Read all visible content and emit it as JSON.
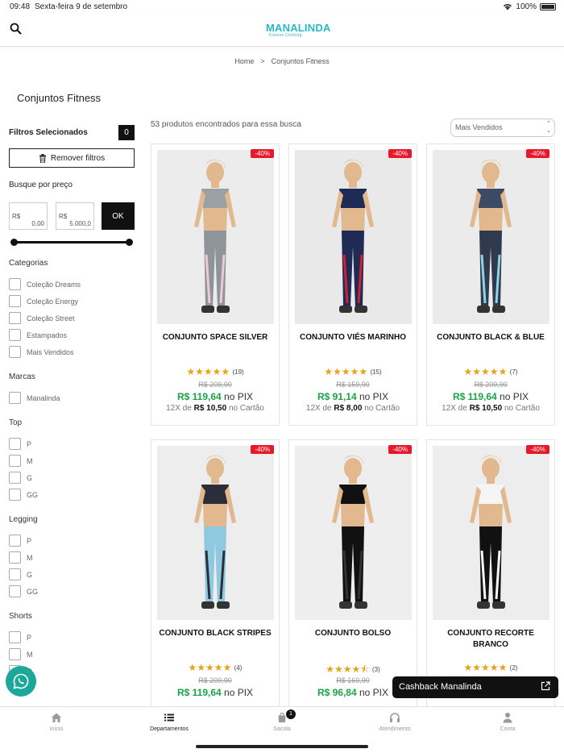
{
  "status_bar": {
    "time": "09:48",
    "date": "Sexta-feira 9 de setembro",
    "battery": "100%"
  },
  "header": {
    "logo_text": "MANALINDA",
    "logo_tagline": "Fitness Clothing",
    "logo_color": "#2ab7c9"
  },
  "breadcrumb": {
    "home": "Home",
    "separator": ">",
    "current": "Conjuntos Fitness"
  },
  "page_title": "Conjuntos Fitness",
  "filters": {
    "selected_label": "Filtros Selecionados",
    "selected_count": "0",
    "remove_label": "Remover filtros",
    "price_label": "Busque por preço",
    "min_currency": "R$",
    "min_value": "0,00",
    "max_currency": "R$",
    "max_value": "5.000,0",
    "ok_label": "OK",
    "groups": [
      {
        "title": "Categorias",
        "items": [
          "Coleção Dreams",
          "Coleção Energy",
          "Coleção Street",
          "Estampados",
          "Mais Vendidos"
        ]
      },
      {
        "title": "Marcas",
        "items": [
          "Manalinda"
        ]
      },
      {
        "title": "Top",
        "items": [
          "P",
          "M",
          "G",
          "GG"
        ]
      },
      {
        "title": "Legging",
        "items": [
          "P",
          "M",
          "G",
          "GG"
        ]
      },
      {
        "title": "Shorts",
        "items": [
          "P",
          "M",
          "G"
        ]
      }
    ]
  },
  "results": {
    "count_text": "53 produtos encontrados para essa busca",
    "sort_value": "Mais Vendidos"
  },
  "products": [
    {
      "name": "CONJUNTO SPACE SILVER",
      "discount": "-40%",
      "stars": 5,
      "reviews": "(19)",
      "old_price": "R$ 209,90",
      "pix_price": "R$ 119,64",
      "pix_label": "no PIX",
      "installments_prefix": "12X de",
      "installment_value": "R$ 10,50",
      "installments_suffix": "no Cartão"
    },
    {
      "name": "CONJUNTO VIÉS MARINHO",
      "discount": "-40%",
      "stars": 5,
      "reviews": "(15)",
      "old_price": "R$ 159,90",
      "pix_price": "R$ 91,14",
      "pix_label": "no PIX",
      "installments_prefix": "12X de",
      "installment_value": "R$ 8,00",
      "installments_suffix": "no Cartão"
    },
    {
      "name": "CONJUNTO BLACK & BLUE",
      "discount": "-40%",
      "stars": 5,
      "reviews": "(7)",
      "old_price": "R$ 209,90",
      "pix_price": "R$ 119,64",
      "pix_label": "no PIX",
      "installments_prefix": "12X de",
      "installment_value": "R$ 10,50",
      "installments_suffix": "no Cartão"
    },
    {
      "name": "CONJUNTO BLACK STRIPES",
      "discount": "-40%",
      "stars": 5,
      "reviews": "(4)",
      "old_price": "R$ 209,90",
      "pix_price": "R$ 119,64",
      "pix_label": "no PIX"
    },
    {
      "name": "CONJUNTO BOLSO",
      "discount": "-40%",
      "stars": 4.5,
      "reviews": "(3)",
      "old_price": "R$ 169,90",
      "pix_price": "R$ 96,84",
      "pix_label": "no PIX"
    },
    {
      "name": "CONJUNTO RECORTE BRANCO",
      "discount": "-40%",
      "stars": 5,
      "reviews": "(2)"
    }
  ],
  "cashback_label": "Cashback Manalinda",
  "tabbar": [
    {
      "label": "Início",
      "icon": "home-icon"
    },
    {
      "label": "Departamentos",
      "icon": "list-icon"
    },
    {
      "label": "Sacola",
      "icon": "bag-icon",
      "badge": "1"
    },
    {
      "label": "Atendimento",
      "icon": "headset-icon"
    },
    {
      "label": "Conta",
      "icon": "user-icon"
    }
  ],
  "colors": {
    "discount_badge": "#e8182a",
    "pix_price": "#18a445",
    "star": "#e6a317",
    "whatsapp": "#1ba79a"
  }
}
